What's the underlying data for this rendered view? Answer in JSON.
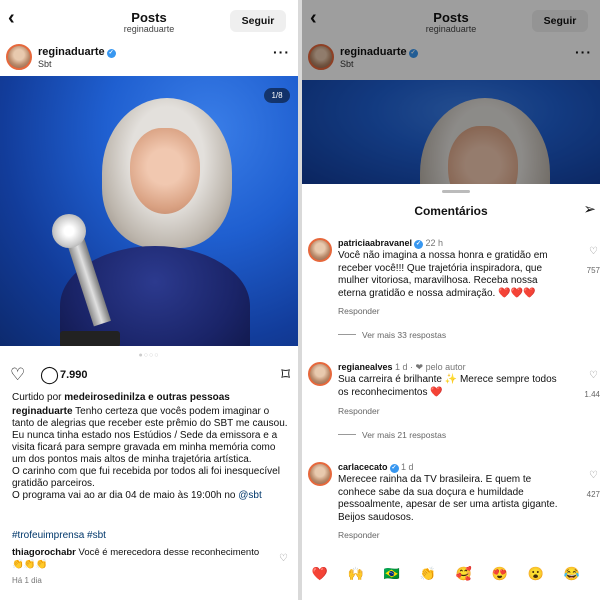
{
  "left": {
    "header": {
      "back_icon": "‹",
      "title": "Posts",
      "subtitle": "reginaduarte",
      "follow_label": "Seguir"
    },
    "post_user": {
      "username": "reginaduarte",
      "location": "Sbt",
      "more_icon": "···"
    },
    "media": {
      "counter": "1/8",
      "dots": "●○○○"
    },
    "actions": {
      "like_icon": "♡",
      "comment_icon": "◯",
      "comment_count": "7.990",
      "save_icon": "⌑"
    },
    "likes": {
      "prefix": "Curtido por ",
      "user": "medeirosedinilza",
      "suffix": " e outras pessoas"
    },
    "caption": {
      "username": "reginaduarte",
      "p1": " Tenho certeza que vocês podem imaginar o tanto de alegrias que receber este prêmio do SBT me causou.",
      "p2": "Eu nunca tinha estado nos Estúdios / Sede da emissora e a visita ficará para sempre gravada em minha memória como um dos pontos mais altos de minha trajetória artística.",
      "p3": "O carinho com que fui recebida por todos ali foi inesquecível gratidão parceiros.",
      "p4": "O programa vai ao ar dia 04 de maio às 19:00h no ",
      "p4_mention": "@sbt"
    },
    "hashtags": "#trofeuimprensa #sbt",
    "first_comment": {
      "username": "thiagorochabr",
      "text": " Você é merecedora desse reconhecimento 👏👏👏",
      "time": "Há 1 dia"
    }
  },
  "right": {
    "header": {
      "back_icon": "‹",
      "title": "Posts",
      "subtitle": "reginaduarte",
      "follow_label": "Seguir"
    },
    "post_user": {
      "username": "reginaduarte",
      "location": "Sbt",
      "more_icon": "···"
    },
    "sheet_title": "Comentários",
    "send_icon": "➢",
    "comments": [
      {
        "username": "patriciaabravanel",
        "meta": " 22 h",
        "text": "Você não imagina a nossa honra e gratidão em receber você!!! Que trajetória inspiradora, que mulher vitoriosa, maravilhosa. Receba nossa eterna gratidão e nossa admiração. ❤️❤️❤️",
        "reply": "Responder",
        "more": "Ver mais 33 respostas",
        "likes": "757"
      },
      {
        "username": "regianealves",
        "meta": " 1 d · ❤ pelo autor",
        "text": "Sua carreira é brilhante ✨ Merece sempre todos os reconhecimentos ❤️",
        "reply": "Responder",
        "more": "Ver mais 21 respostas",
        "likes": "1.44"
      },
      {
        "username": "carlacecato",
        "meta": " 1 d",
        "text": "Merecee rainha da TV brasileira. E quem te conhece sabe da sua doçura e humildade pessoalmente, apesar de ser uma artista gigante. Beijos saudosos.",
        "reply": "Responder",
        "likes": "427"
      }
    ],
    "emoji_bar": [
      "❤️",
      "🙌",
      "🇧🇷",
      "👏",
      "🥰",
      "😍",
      "😮",
      "😂"
    ]
  },
  "colors": {
    "link": "#00376b",
    "verified": "#3897f0",
    "heart": "#ed4956"
  }
}
